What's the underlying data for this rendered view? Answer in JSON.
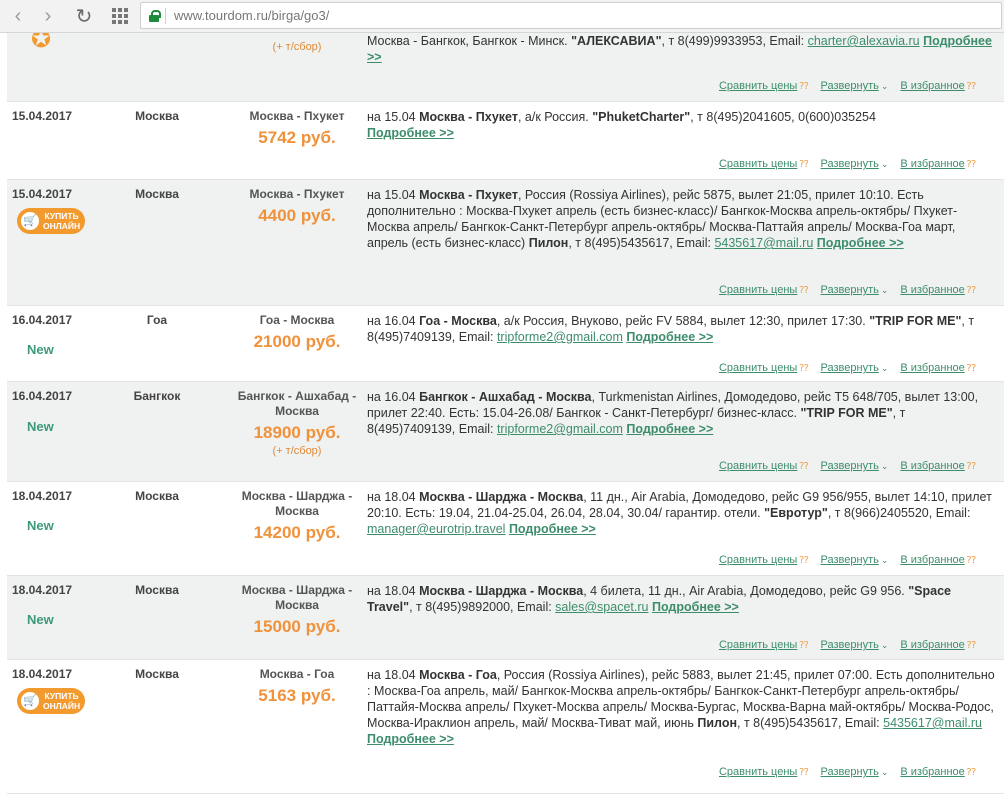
{
  "browser": {
    "url": "www.tourdom.ru/birga/go3/"
  },
  "actions": {
    "compare": "Сравнить цены",
    "expand": "Развернуть",
    "favorite": "В избранное"
  },
  "labels": {
    "new": "New",
    "buy_line1": "КУПИТЬ",
    "buy_line2": "ОНЛАЙН"
  },
  "rows": [
    {
      "date": "",
      "city": "",
      "route": "",
      "price": "",
      "tax": "(+ т/сбор)",
      "desc_html": "Москва - Бангкок, Бангкок - Минск. <b>\"АЛЕКСАВИА\"</b>, т 8(499)9933953, Email: <span class=\"lnk\">charter@alexavia.ru</span> <span class=\"more\">Подробнее &gt;&gt;</span>"
    },
    {
      "date": "15.04.2017",
      "city": "Москва",
      "route": "Москва - Пхукет",
      "price": "5742 руб.",
      "tax": "",
      "desc_html": "на 15.04 <b>Москва - Пхукет</b>, а/к Россия. <b>\"PhuketCharter\"</b>, т 8(495)2041605, 0(600)035254 <br><span class=\"more\">Подробнее &gt;&gt;</span>"
    },
    {
      "date": "15.04.2017",
      "city": "Москва",
      "route": "Москва - Пхукет",
      "price": "4400 руб.",
      "tax": "",
      "desc_html": "на 15.04 <b>Москва - Пхукет</b>, Россия (Rossiya Airlines), рейс 5875, вылет 21:05, прилет 10:10. Есть дополнительно : Москва-Пхукет апрель (есть бизнес-класс)/ Бангкок-Москва апрель-октябрь/ Пхукет-Москва апрель/ Бангкок-Санкт-Петербург апрель-октябрь/ Москва-Паттайя апрель/ Москва-Гоа март, апрель (есть бизнес-класс) <b>Пилон</b>, т 8(495)5435617, Email: <span class=\"lnk\">5435617@mail.ru</span> <span class=\"more\">Подробнее &gt;&gt;</span>"
    },
    {
      "date": "16.04.2017",
      "city": "Гоа",
      "route": "Гоа - Москва",
      "price": "21000 руб.",
      "tax": "",
      "desc_html": "на 16.04 <b>Гоа - Москва</b>, а/к Россия, Внуково, рейс FV 5884, вылет 12:30, прилет 17:30. <b>\"TRIP FOR ME\"</b>, т 8(495)7409139, Email: <span class=\"lnk\">tripforme2@gmail.com</span> <span class=\"more\">Подробнее &gt;&gt;</span>"
    },
    {
      "date": "16.04.2017",
      "city": "Бангкок",
      "route": "Бангкок - Ашхабад - Москва",
      "price": "18900 руб.",
      "tax": "(+ т/сбор)",
      "desc_html": "на 16.04 <b>Бангкок - Ашхабад - Москва</b>, Turkmenistan Airlines, Домодедово, рейс Т5 648/705, вылет 13:00, прилет 22:40. Есть: 15.04-26.08/ Бангкок - Санкт-Петербург/ бизнес-класс. <b>\"TRIP FOR ME\"</b>, т 8(495)7409139, Email: <span class=\"lnk\">tripforme2@gmail.com</span> <span class=\"more\">Подробнее &gt;&gt;</span>"
    },
    {
      "date": "18.04.2017",
      "city": "Москва",
      "route": "Москва - Шарджа - Москва",
      "price": "14200 руб.",
      "tax": "",
      "desc_html": "на 18.04 <b>Москва - Шарджа - Москва</b>, 11 дн., Air Arabia, Домодедово, рейс G9 956/955, вылет 14:10, прилет 20:10. Есть: 19.04, 21.04-25.04, 26.04, 28.04, 30.04/ гарантир. отели. <b>\"Евротур\"</b>, т 8(966)2405520, Email: <span class=\"lnk\">manager@eurotrip.travel</span> <span class=\"more\">Подробнее &gt;&gt;</span>"
    },
    {
      "date": "18.04.2017",
      "city": "Москва",
      "route": "Москва - Шарджа - Москва",
      "price": "15000 руб.",
      "tax": "",
      "desc_html": "на 18.04 <b>Москва - Шарджа - Москва</b>, 4 билета, 11 дн., Air Arabia, Домодедово, рейс G9 956. <b>\"Space Travel\"</b>, т 8(495)9892000, Email: <span class=\"lnk\">sales@spacet.ru</span> <span class=\"more\">Подробнее &gt;&gt;</span>"
    },
    {
      "date": "18.04.2017",
      "city": "Москва",
      "route": "Москва - Гоа",
      "price": "5163 руб.",
      "tax": "",
      "desc_html": "на 18.04 <b>Москва - Гоа</b>, Россия (Rossiya Airlines), рейс 5883, вылет 21:45, прилет 07:00. Есть дополнительно : Москва-Гоа апрель, май/ Бангкок-Москва апрель-октябрь/ Бангкок-Санкт-Петербург апрель-октябрь/ Паттайя-Москва апрель/ Пхукет-Москва апрель/ Москва-Бургас, Москва-Варна май-октябрь/ Москва-Родос, Москва-Ираклион апрель, май/ Москва-Тиват май, июнь <b>Пилон</b>, т 8(495)5435617, Email: <span class=\"lnk\">5435617@mail.ru</span> <span class=\"more\">Подробнее &gt;&gt;</span>"
    }
  ]
}
